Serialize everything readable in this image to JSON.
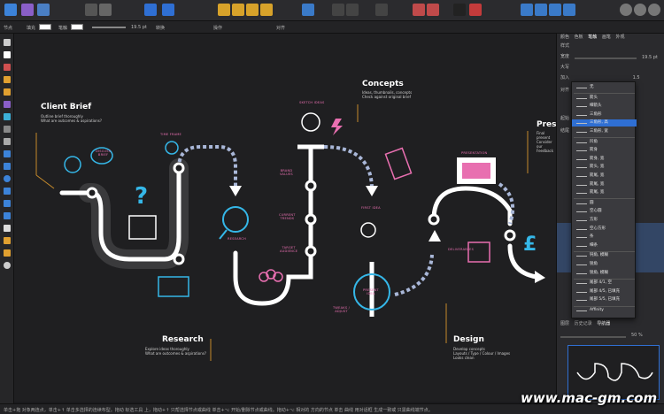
{
  "context_bar": {
    "node_label": "节点",
    "fill_label": "填充",
    "stroke_label": "笔触",
    "stroke_width": "19.5 pt",
    "transform_label": "转换",
    "action_label": "操作",
    "snap_label": "对齐"
  },
  "canvas": {
    "client_brief": {
      "title": "Client Brief",
      "desc": "Outline brief thoroughly\nWhat are outcomes & aspirations?"
    },
    "concepts": {
      "title": "Concepts",
      "desc": "Ideas, thumbnails, concepts\nCheck against original brief"
    },
    "research": {
      "title": "Research",
      "desc": "Explore ideas thoroughly\nWhat are outcomes & aspirations?"
    },
    "design": {
      "title": "Design",
      "desc": "Develop concepts\nLayouts / Type / Colour / Images\nLooks clean"
    },
    "presentation_partial": {
      "title": "Pres",
      "desc": "Final present\nConsider our\nFeedback"
    },
    "labels": {
      "discuss": "DISCUSS\nBRIEF",
      "time_frame": "TIME FRAME",
      "research": "RESEARCH",
      "brand_values": "BRAND\nVALUES",
      "current_trends": "CURRENT\nTRENDS",
      "target_audience": "TARGET\nAUDIENCE",
      "sketch_ideas": "SKETCH IDEAS",
      "first_idea": "FIRST IDEA",
      "present_idea": "PRESENT\nIDEA",
      "tweaks": "TWEAKS /\nADJUST",
      "presentation": "PRESENTATION",
      "deliverables": "DELIVERABLES"
    }
  },
  "panel": {
    "tabs": [
      "颜色",
      "色板",
      "笔触",
      "画笔",
      "外观"
    ],
    "style_label": "样式",
    "width_label": "宽度",
    "width_value": "19.5 pt",
    "cap_label": "大写",
    "join_label": "加入",
    "join_value": "1.5",
    "align_label": "对齐",
    "start_label": "起始",
    "end_label": "结尾",
    "layers_tabs": [
      "图层",
      "历史记录",
      "导航器"
    ],
    "zoom_value": "50 %"
  },
  "arrowhead_menu": {
    "items": [
      {
        "label": "无",
        "selected": false
      },
      {
        "label": "箭头",
        "selected": false
      },
      {
        "label": "细箭头",
        "selected": false
      },
      {
        "label": "三角形",
        "selected": false
      },
      {
        "label": "三角形, 高",
        "selected": true
      },
      {
        "label": "三角形, 宽",
        "selected": false
      },
      {
        "label": "凹角",
        "selected": false
      },
      {
        "label": "箭身",
        "selected": false
      },
      {
        "label": "箭身, 宽",
        "selected": false
      },
      {
        "label": "箭头, 宽",
        "selected": false
      },
      {
        "label": "箭尾, 宽",
        "selected": false
      },
      {
        "label": "箭尾, 宽",
        "selected": false
      },
      {
        "label": "箭尾, 宽",
        "selected": false
      },
      {
        "label": "圆",
        "selected": false
      },
      {
        "label": "空心圆",
        "selected": false
      },
      {
        "label": "方形",
        "selected": false
      },
      {
        "label": "空心方形",
        "selected": false
      },
      {
        "label": "条",
        "selected": false
      },
      {
        "label": "细条",
        "selected": false
      },
      {
        "label": "钝角, 模糊",
        "selected": false
      },
      {
        "label": "锐角",
        "selected": false
      },
      {
        "label": "锐角, 模糊",
        "selected": false
      },
      {
        "label": "尾部 4/1, 空",
        "selected": false
      },
      {
        "label": "尾部 4/5, 已填充",
        "selected": false
      },
      {
        "label": "尾部 5/5, 已填充",
        "selected": false
      },
      {
        "label": "Affinity",
        "selected": false
      }
    ]
  },
  "status_bar": {
    "text": "单击+拖 对象两连点，单击+↑ 单击多选择的连续布型。拖动 标选工具 上，拖动+↑ 只帮选择节点或曲线  单击+⌥ 开始/删除节点或曲线。拖动+⌥ 相对的 方向的节点 单击 曲线 用对话框 生成一致或 只需曲线端节点。"
  },
  "watermark": "www.mac-gm.com",
  "colors": {
    "accent_blue": "#2f6fd3",
    "pink": "#e86fb0",
    "cyan": "#35b7e8",
    "dash_blue": "#a9b7d8"
  }
}
